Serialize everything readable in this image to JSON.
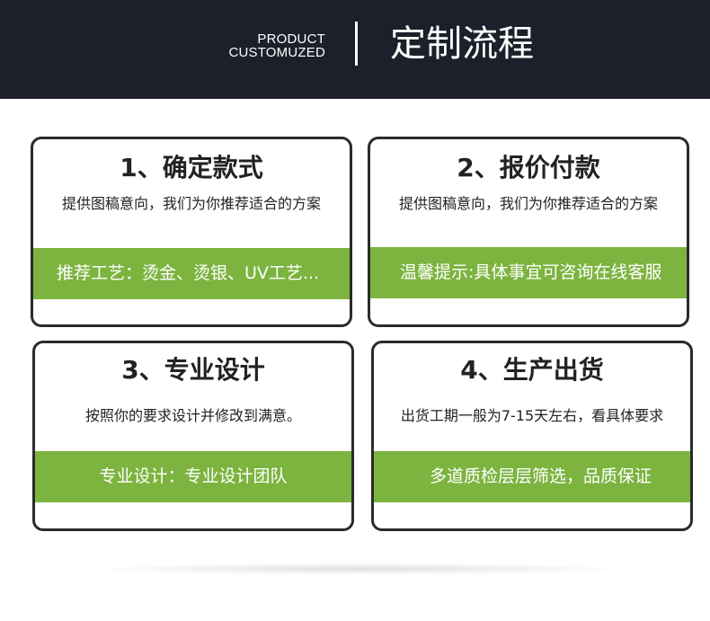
{
  "header": {
    "en_line1": "PRODUCT",
    "en_line2": "CUSTOMUZED",
    "title": "定制流程"
  },
  "cards": [
    {
      "title": "1、确定款式",
      "desc": "提供图稿意向，我们为你推荐适合的方案",
      "band": "推荐工艺：烫金、烫银、UV工艺..."
    },
    {
      "title": "2、报价付款",
      "desc": "提供图稿意向，我们为你推荐适合的方案",
      "band": "温馨提示:具体事宜可咨询在线客服"
    },
    {
      "title": "3、专业设计",
      "desc": "按照你的要求设计并修改到满意。",
      "band": "专业设计：专业设计团队"
    },
    {
      "title": "4、生产出货",
      "desc": "出货工期一般为7-15天左右，看具体要求",
      "band": "多道质检层层筛选，品质保证"
    }
  ],
  "colors": {
    "header_bg": "#1c202a",
    "accent_green": "#7cb43f",
    "border": "#2b2b2b"
  }
}
